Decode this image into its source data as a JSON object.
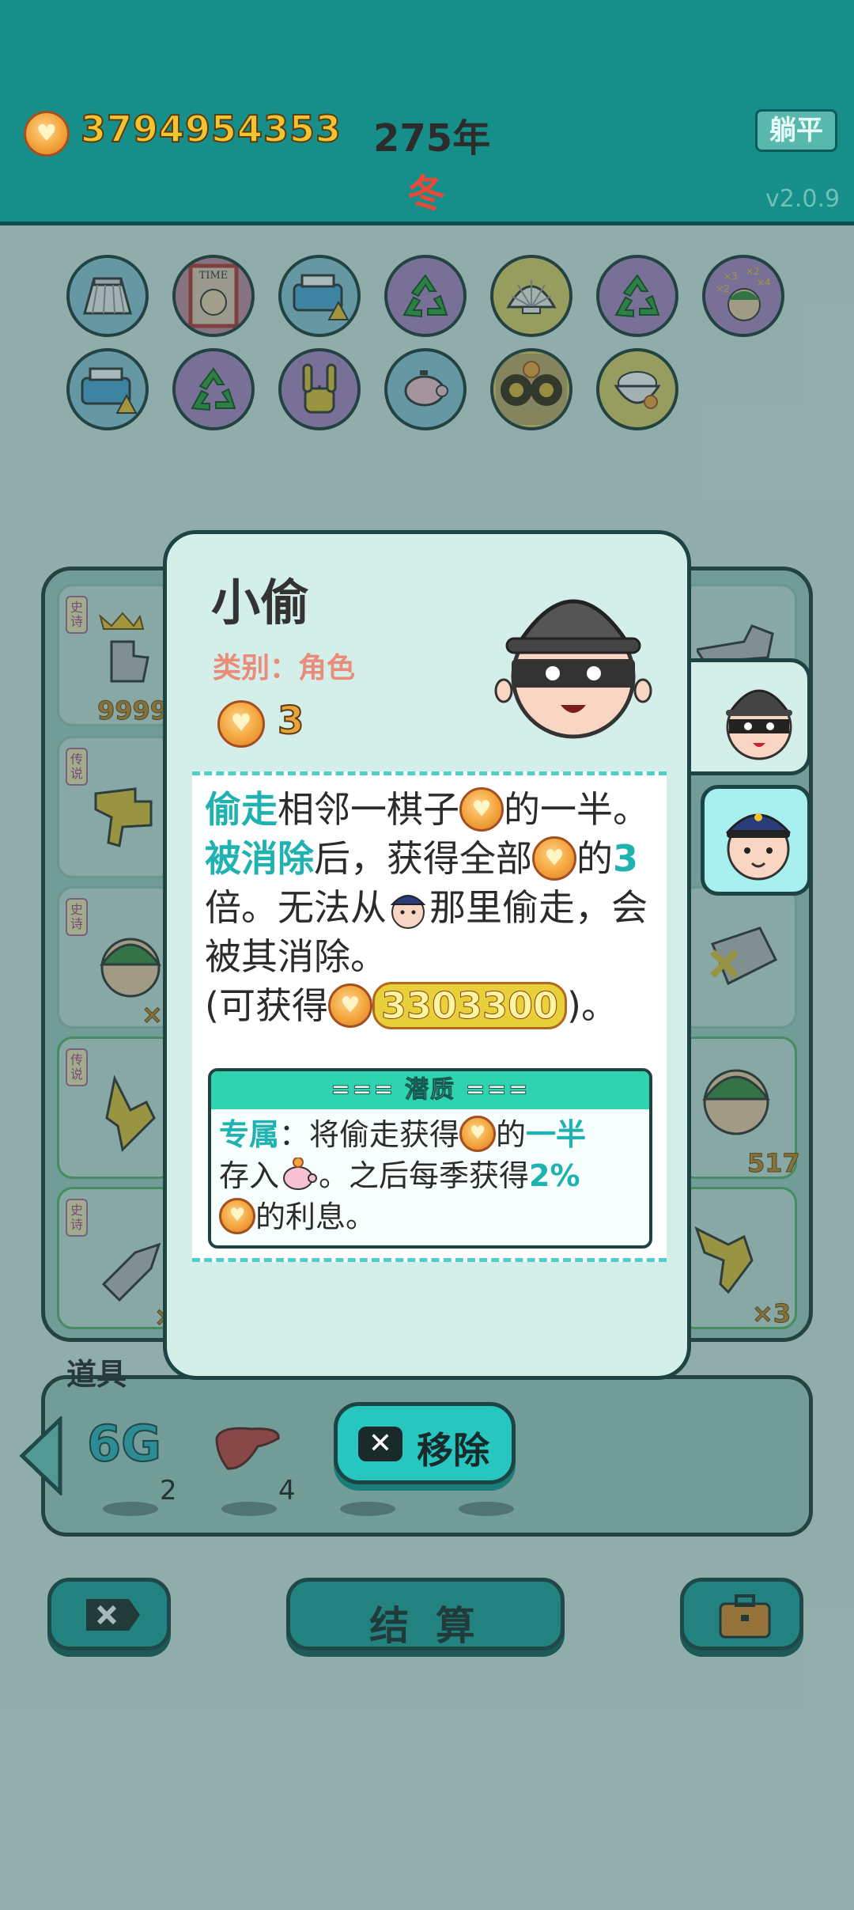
{
  "topbar": {
    "gold": "3794954353",
    "year": "275年",
    "season": "冬",
    "lie_flat_label": "躺平",
    "version": "v2.0.9"
  },
  "relics": [
    {
      "icon": "skirt-icon"
    },
    {
      "icon": "time-magazine-icon"
    },
    {
      "icon": "printer-warning-icon"
    },
    {
      "icon": "recycle-icon"
    },
    {
      "icon": "seashell-icon"
    },
    {
      "icon": "recycle-icon"
    },
    {
      "icon": "multiplier-face-icon"
    },
    {
      "icon": "printer-warning-icon"
    },
    {
      "icon": "recycle-icon"
    },
    {
      "icon": "rock-hand-icon"
    },
    {
      "icon": "piggy-bank-icon"
    },
    {
      "icon": "owl-icon"
    },
    {
      "icon": "rice-bowl-icon"
    }
  ],
  "board": {
    "left_tags": [
      "史诗",
      "传说",
      "史诗",
      "传说",
      "史诗"
    ],
    "slot_numbers": {
      "crown_slot": "9999",
      "left_x": "×",
      "right_517": "517",
      "right_x3": "×3",
      "left_bottom_x": "×"
    }
  },
  "card": {
    "name": "小偷",
    "category": "类别：角色",
    "price": "3",
    "description": {
      "kw_steal": "偷走",
      "t1": "相邻一棋子",
      "t2": "的一半。",
      "kw_eliminated": "被消除",
      "t3": "后，获得全部",
      "t4": "的",
      "kw_3": "3",
      "t5": "倍。无法从",
      "t6": "那里偷走，会被其消除。",
      "t7": "(可获得",
      "gain": "3303300",
      "t8": ")。"
    },
    "trait": {
      "header": "=== 潜质 ===",
      "kw_exclusive": "专属",
      "t1": "：将偷走获得",
      "t2": "的",
      "kw_half": "一半",
      "t3": "存入",
      "t4": "。之后每季获得",
      "kw_rate": "2%",
      "t5": "的利息。"
    }
  },
  "items": {
    "title": "道具",
    "item1_label": "6G",
    "item1_count": "2",
    "item2_count": "4",
    "remove_label": "移除"
  },
  "bottom": {
    "settle_label": "结 算"
  },
  "colors": {
    "teal": "#168f8b",
    "accent": "#1fb2b0",
    "gold": "#f3c431",
    "season_red": "#e84a3a"
  }
}
